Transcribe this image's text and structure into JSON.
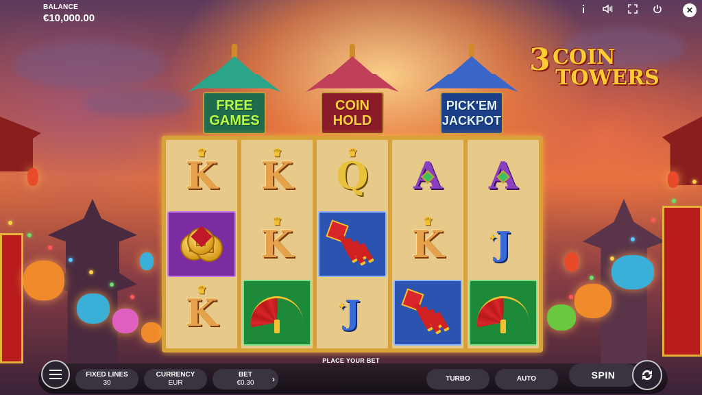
{
  "header": {
    "balance_label": "BALANCE",
    "balance_value": "€10,000.00",
    "icons": [
      "info-icon",
      "sound-icon",
      "fullscreen-icon",
      "power-icon",
      "close-icon"
    ]
  },
  "logo": {
    "number": "3",
    "word1": "COIN",
    "word2": "TOWERS"
  },
  "towers": [
    {
      "line1": "FREE",
      "line2": "GAMES",
      "color": "#1f6d4e"
    },
    {
      "line1": "COIN",
      "line2": "HOLD",
      "color": "#8a1c2a"
    },
    {
      "line1": "PICK'EM",
      "line2": "JACKPOT",
      "color": "#1c3f8a"
    }
  ],
  "reels": [
    [
      "K",
      "coins",
      "K"
    ],
    [
      "K",
      "K",
      "fan"
    ],
    [
      "Q",
      "firecracker",
      "J"
    ],
    [
      "A",
      "K",
      "firecracker"
    ],
    [
      "A",
      "J",
      "fan"
    ]
  ],
  "footer": {
    "place_bet": "PLACE YOUR BET",
    "fixed_lines_label": "FIXED LINES",
    "fixed_lines_value": "30",
    "currency_label": "CURRENCY",
    "currency_value": "EUR",
    "bet_label": "BET",
    "bet_value": "€0.30",
    "turbo_label": "TURBO",
    "auto_label": "AUTO",
    "spin_label": "SPIN"
  },
  "colors": {
    "reel_frame": "#d8a23a",
    "reel_bg": "#e7c98a",
    "bar_bg": "#3a3440"
  }
}
